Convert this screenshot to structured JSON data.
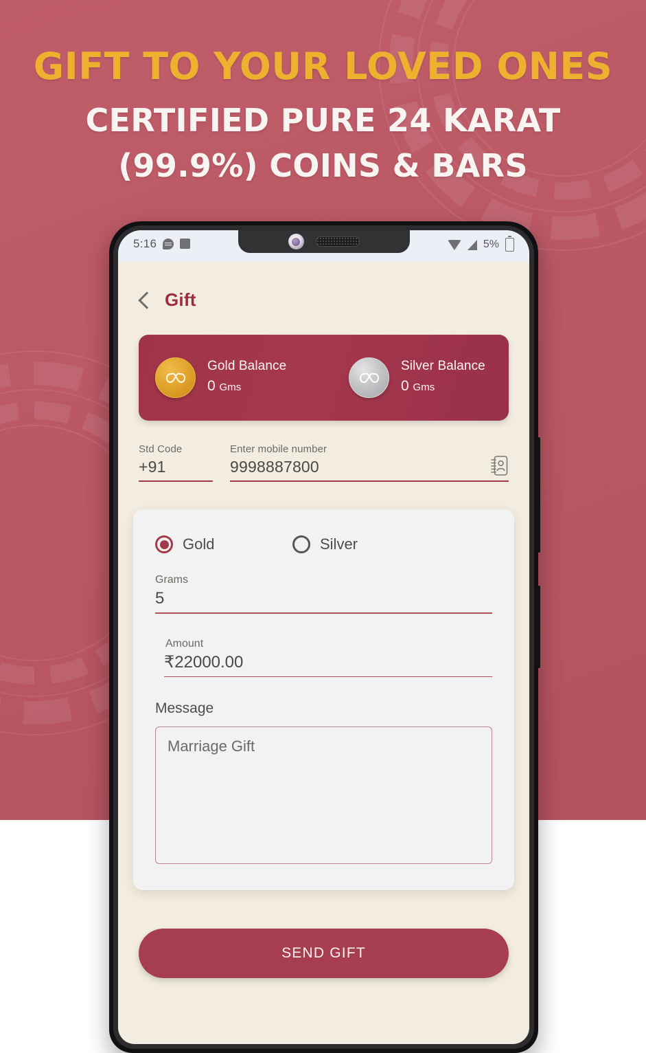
{
  "promo": {
    "headline_line1": "GIFT TO YOUR LOVED ONES",
    "headline_line2": "CERTIFIED PURE 24 KARAT",
    "headline_line3": "(99.9%) COINS & BARS",
    "bg_color": "#bd5663",
    "accent_gold": "#eeb12f",
    "headline_white": "#f7f4f2"
  },
  "status_bar": {
    "time": "5:16",
    "battery_percent": "5%",
    "icons": [
      "chat-bubble-icon",
      "square-icon",
      "wifi-icon",
      "signal-icon",
      "battery-icon"
    ]
  },
  "app_bar": {
    "back_icon": "back-chevron-icon",
    "title": "Gift",
    "title_color": "#9d2c3f"
  },
  "balance_card": {
    "bg_color": "#9f3347",
    "gold": {
      "icon": "gold-coin-icon",
      "label": "Gold Balance",
      "value": "0",
      "unit": "Gms"
    },
    "silver": {
      "icon": "silver-coin-icon",
      "label": "Silver Balance",
      "value": "0",
      "unit": "Gms"
    }
  },
  "recipient": {
    "std_code_label": "Std Code",
    "std_code_value": "+91",
    "mobile_label": "Enter mobile number",
    "mobile_value": "9998887800",
    "contacts_icon": "contacts-book-icon"
  },
  "form": {
    "metal_options": [
      {
        "label": "Gold",
        "selected": true
      },
      {
        "label": "Silver",
        "selected": false
      }
    ],
    "grams_label": "Grams",
    "grams_value": "5",
    "amount_label": "Amount",
    "amount_value": "₹22000.00",
    "message_label": "Message",
    "message_value": "Marriage Gift"
  },
  "send_button": {
    "label": "SEND GIFT",
    "color": "#a73e4f"
  }
}
